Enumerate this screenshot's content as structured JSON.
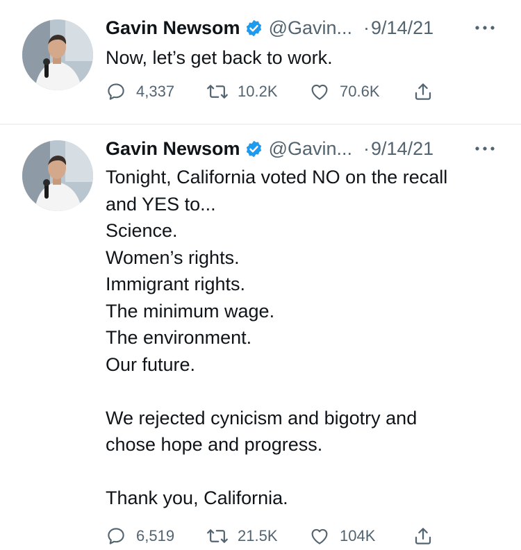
{
  "tweets": [
    {
      "author_name": "Gavin Newsom",
      "handle": "@Gavin...",
      "separator": "·",
      "date": "9/14/21",
      "text_lines": [
        "Now, let’s get back to work."
      ],
      "replies": "4,337",
      "retweets": "10.2K",
      "likes": "70.6K"
    },
    {
      "author_name": "Gavin Newsom",
      "handle": "@Gavin...",
      "separator": "·",
      "date": "9/14/21",
      "text_lines": [
        "Tonight, California voted NO on the recall",
        "and YES to...",
        "Science.",
        "Women’s rights.",
        "Immigrant rights.",
        "The minimum wage.",
        "The environment.",
        "Our future.",
        "",
        "We rejected cynicism and bigotry and",
        "chose hope and progress.",
        "",
        "Thank you, California."
      ],
      "replies": "6,519",
      "retweets": "21.5K",
      "likes": "104K"
    }
  ],
  "icons": {
    "verified": "verified-badge-icon",
    "more": "more-dots-icon",
    "reply": "reply-bubble-icon",
    "retweet": "retweet-arrows-icon",
    "like": "heart-icon",
    "share": "share-upload-icon"
  },
  "colors": {
    "text": "#0f1419",
    "secondary": "#536471",
    "verified_blue": "#1d9bf0",
    "divider": "#eff3f4",
    "background": "#ffffff"
  }
}
